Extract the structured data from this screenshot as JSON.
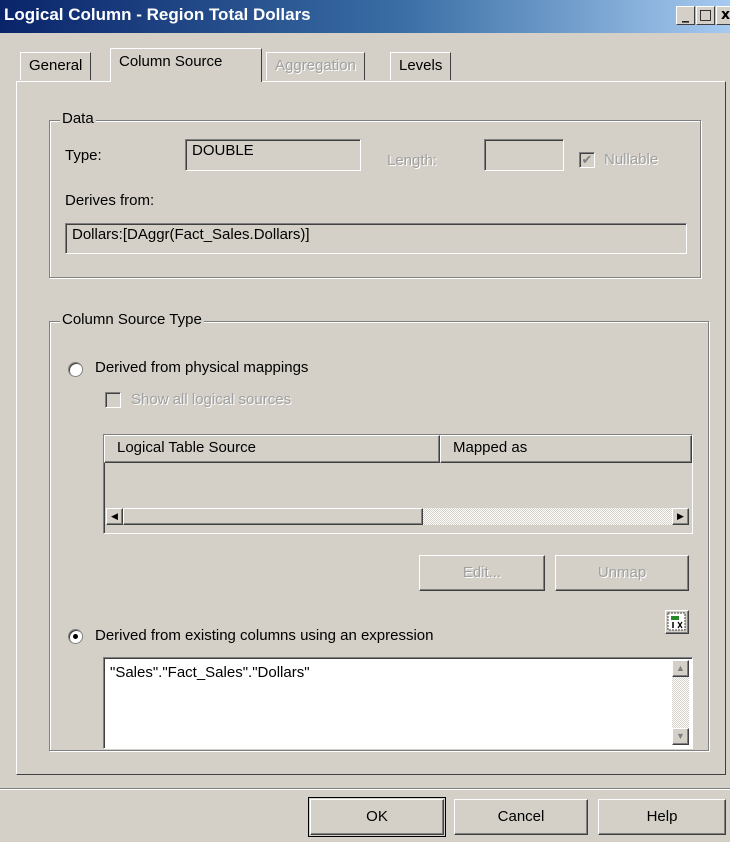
{
  "window": {
    "title": "Logical Column - Region Total Dollars",
    "minimize_glyph": "_",
    "maximize_glyph": "□",
    "close_glyph": "x"
  },
  "tabs": [
    {
      "label": "General",
      "state": "normal"
    },
    {
      "label": "Column Source",
      "state": "active"
    },
    {
      "label": "Aggregation",
      "state": "disabled"
    },
    {
      "label": "Levels",
      "state": "normal"
    }
  ],
  "data_group": {
    "label": "Data",
    "type_label": "Type:",
    "type_value": "DOUBLE",
    "length_label": "Length:",
    "length_value": "",
    "nullable_label": "Nullable",
    "nullable_checked": true,
    "derives_from_label": "Derives from:",
    "derives_from_value": "Dollars:[DAggr(Fact_Sales.Dollars)]"
  },
  "source_type_group": {
    "label": "Column Source Type",
    "physical_radio_label": "Derived from physical mappings",
    "physical_selected": false,
    "show_all_label": "Show all logical sources",
    "show_all_checked": false,
    "table_columns": [
      "Logical Table Source",
      "Mapped as"
    ],
    "table_rows": [],
    "edit_button": "Edit...",
    "unmap_button": "Unmap",
    "expression_radio_label": "Derived from existing columns using an expression",
    "expression_selected": true,
    "expression_value": "\"Sales\".\"Fact_Sales\".\"Dollars\"",
    "expression_builder_icon": "expression-builder-icon"
  },
  "footer": {
    "ok_button": "OK",
    "cancel_button": "Cancel",
    "help_button": "Help"
  },
  "colors": {
    "titlebar_start": "#0a246a",
    "titlebar_end": "#a6caf0",
    "face": "#d4d0c8",
    "disabled_text": "#a0a0a0"
  }
}
